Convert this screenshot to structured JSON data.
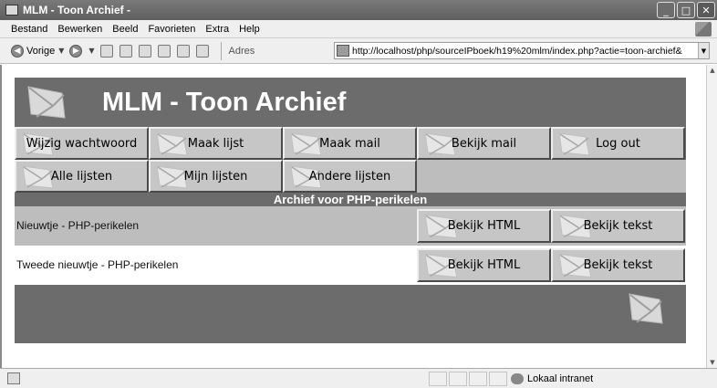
{
  "window": {
    "title": "MLM - Toon Archief -",
    "buttons": {
      "minimize": "_",
      "maximize": "□",
      "close": "✕"
    }
  },
  "menu": {
    "items": [
      "Bestand",
      "Bewerken",
      "Beeld",
      "Favorieten",
      "Extra",
      "Help"
    ]
  },
  "toolbar": {
    "back_label": "Vorige",
    "address_label": "Adres",
    "address_value": "http://localhost/php/sourceIPboek/h19%20mlm/index.php?actie=toon-archief&"
  },
  "page": {
    "title": "MLM - Toon Archief",
    "nav_row1": [
      "Wijzig wachtwoord",
      "Maak lijst",
      "Maak mail",
      "Bekijk mail",
      "Log out"
    ],
    "nav_row2": [
      "Alle lijsten",
      "Mijn lijsten",
      "Andere lijsten"
    ],
    "section_title": "Archief voor PHP-perikelen",
    "items": [
      {
        "title": "Nieuwtje - PHP-perikelen",
        "html_label": "Bekijk HTML",
        "text_label": "Bekijk tekst"
      },
      {
        "title": "Tweede nieuwtje - PHP-perikelen",
        "html_label": "Bekijk HTML",
        "text_label": "Bekijk tekst"
      }
    ]
  },
  "statusbar": {
    "zone": "Lokaal intranet"
  },
  "colors": {
    "header_bg": "#6c6c6c",
    "button_bg": "#c6c6c6",
    "row_odd": "#bdbdbd",
    "row_even": "#ffffff"
  }
}
